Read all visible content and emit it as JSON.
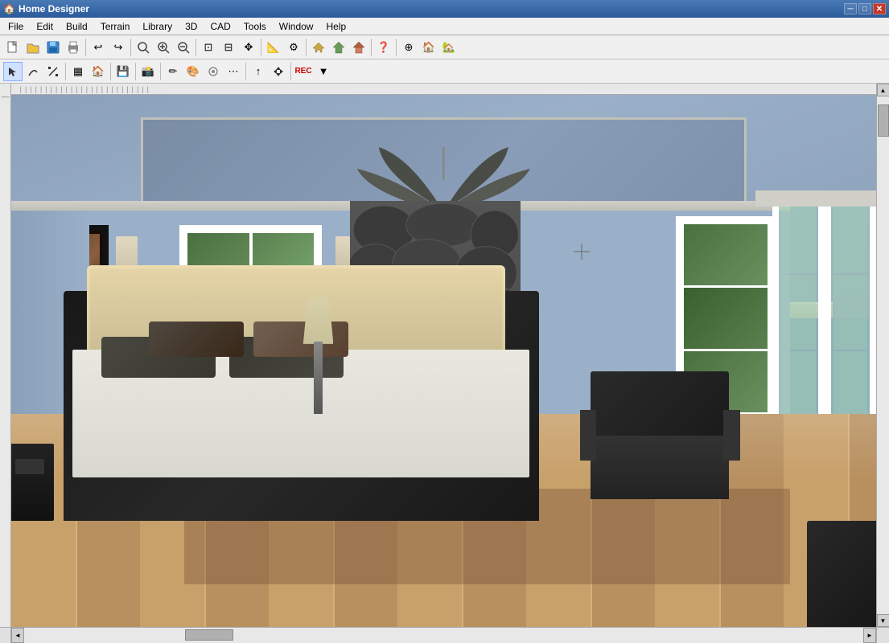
{
  "app": {
    "title": "Home Designer",
    "icon": "🏠"
  },
  "title_bar": {
    "min_label": "─",
    "max_label": "□",
    "close_label": "✕",
    "inner_min": "─",
    "inner_max": "□",
    "inner_close": "✕"
  },
  "menu": {
    "items": [
      "File",
      "Edit",
      "Build",
      "Terrain",
      "Library",
      "3D",
      "CAD",
      "Tools",
      "Window",
      "Help"
    ]
  },
  "toolbar1": {
    "buttons": [
      "📄",
      "📂",
      "💾",
      "🖨",
      "↩",
      "↪",
      "🔍",
      "🔍",
      "🔍",
      "🔍",
      "⊡",
      "⊡",
      "⊡",
      "📐",
      "🔧",
      "📋",
      "🏠",
      "❓"
    ]
  },
  "toolbar2": {
    "buttons": [
      "↖",
      "〜",
      "─",
      "▦",
      "🏠",
      "💾",
      "📋",
      "📸",
      "✏",
      "🎨",
      "🔧",
      "⟳",
      "↑",
      "⟲",
      "▶"
    ]
  },
  "scrollbar": {
    "up_arrow": "▲",
    "down_arrow": "▼",
    "left_arrow": "◄",
    "right_arrow": "►"
  },
  "status": {
    "text": ""
  }
}
